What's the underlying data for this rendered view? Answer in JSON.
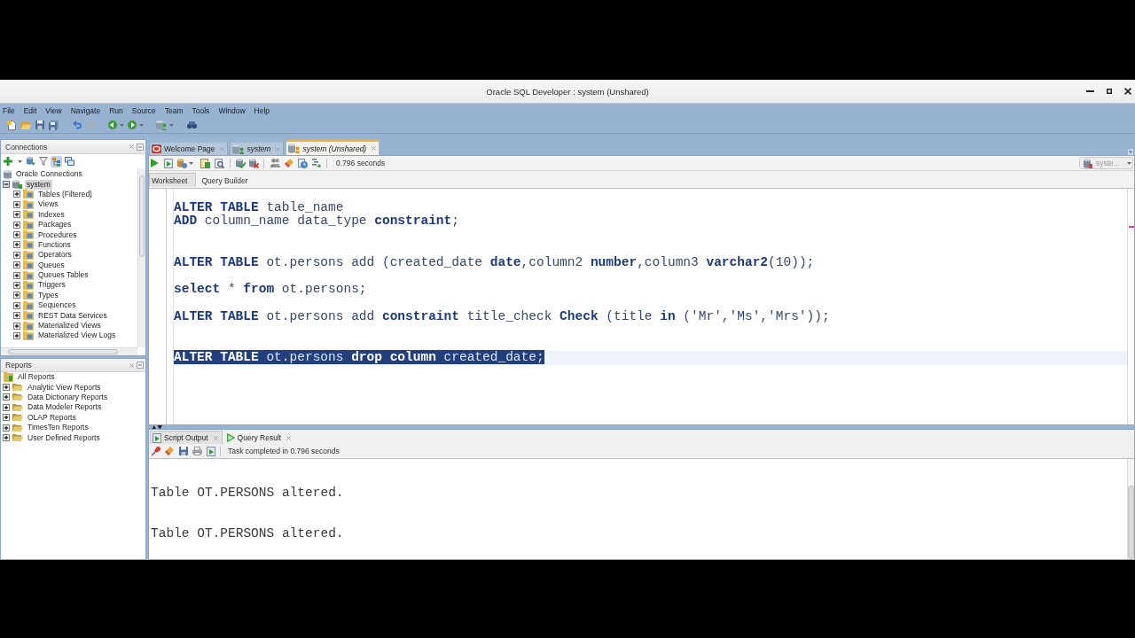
{
  "window": {
    "title": "Oracle SQL Developer : system (Unshared)"
  },
  "menu_bar": [
    "File",
    "Edit",
    "View",
    "Navigate",
    "Run",
    "Source",
    "Team",
    "Tools",
    "Window",
    "Help"
  ],
  "connections_panel": {
    "title": "Connections",
    "tree": [
      {
        "label": "Oracle Connections",
        "selected": false,
        "children": [
          {
            "label": "system",
            "expanded": true,
            "selected": true,
            "children": [
              {
                "label": "Tables (Filtered)",
                "expanded": false,
                "selected": false
              },
              {
                "label": "Views",
                "expanded": false,
                "selected": false
              },
              {
                "label": "Indexes",
                "expanded": false,
                "selected": false
              },
              {
                "label": "Packages",
                "expanded": false,
                "selected": false
              },
              {
                "label": "Procedures",
                "expanded": false,
                "selected": false
              },
              {
                "label": "Functions",
                "expanded": false,
                "selected": false
              },
              {
                "label": "Operators",
                "expanded": false,
                "selected": false
              },
              {
                "label": "Queues",
                "expanded": false,
                "selected": false
              },
              {
                "label": "Queues Tables",
                "expanded": false,
                "selected": false
              },
              {
                "label": "Triggers",
                "expanded": false,
                "selected": false
              },
              {
                "label": "Types",
                "expanded": false,
                "selected": false
              },
              {
                "label": "Sequences",
                "expanded": false,
                "selected": false
              },
              {
                "label": "REST Data Services",
                "expanded": false,
                "selected": false
              },
              {
                "label": "Materialized Views",
                "expanded": false,
                "selected": false
              },
              {
                "label": "Materialized View Logs",
                "expanded": false,
                "selected": false
              }
            ]
          }
        ]
      }
    ]
  },
  "reports_panel": {
    "title": "Reports",
    "tree": [
      {
        "label": "All Reports",
        "selected": false,
        "children": [
          {
            "label": "Analytic View Reports",
            "expanded": false,
            "selected": false
          },
          {
            "label": "Data Dictionary Reports",
            "expanded": false,
            "selected": false
          },
          {
            "label": "Data Modeler Reports",
            "expanded": false,
            "selected": false
          },
          {
            "label": "OLAP Reports",
            "expanded": false,
            "selected": false
          },
          {
            "label": "TimesTen Reports",
            "expanded": false,
            "selected": false
          },
          {
            "label": "User Defined Reports",
            "expanded": false,
            "selected": false
          }
        ]
      }
    ]
  },
  "editor": {
    "tabs": [
      {
        "label": "Welcome Page",
        "selected": false,
        "kind": "welcome"
      },
      {
        "label": "system",
        "selected": false,
        "kind": "worksheet"
      },
      {
        "label": "system (Unshared)",
        "selected": true,
        "kind": "unshared_worksheet"
      }
    ],
    "elapsed": "0.796 seconds",
    "connection_selector": {
      "value": "syste...",
      "disabled": true
    },
    "subtabs": [
      {
        "label": "Worksheet",
        "selected": true
      },
      {
        "label": "Query Builder",
        "selected": false
      }
    ],
    "lines": [
      {
        "kind": "code",
        "selected": false,
        "segments": [
          {
            "kind": "keyword",
            "text": "ALTER TABLE"
          },
          {
            "kind": "plain",
            "text": " table_name"
          }
        ]
      },
      {
        "kind": "code",
        "selected": false,
        "segments": [
          {
            "kind": "keyword",
            "text": "ADD"
          },
          {
            "kind": "plain",
            "text": " column_name data_type "
          },
          {
            "kind": "keyword",
            "text": "constraint"
          },
          {
            "kind": "plain",
            "text": ";"
          }
        ]
      },
      {
        "kind": "blank",
        "selected": false
      },
      {
        "kind": "blank",
        "selected": false
      },
      {
        "kind": "code",
        "selected": false,
        "segments": [
          {
            "kind": "keyword",
            "text": "ALTER TABLE"
          },
          {
            "kind": "plain",
            "text": " ot.persons add (created_date "
          },
          {
            "kind": "keyword",
            "text": "date"
          },
          {
            "kind": "plain",
            "text": ",column2 "
          },
          {
            "kind": "keyword",
            "text": "number"
          },
          {
            "kind": "plain",
            "text": ",column3 "
          },
          {
            "kind": "keyword",
            "text": "varchar2"
          },
          {
            "kind": "plain",
            "text": "(10));"
          }
        ]
      },
      {
        "kind": "blank",
        "selected": false
      },
      {
        "kind": "code",
        "selected": false,
        "segments": [
          {
            "kind": "keyword",
            "text": "select"
          },
          {
            "kind": "plain",
            "text": " * "
          },
          {
            "kind": "keyword",
            "text": "from"
          },
          {
            "kind": "plain",
            "text": " ot.persons;"
          }
        ]
      },
      {
        "kind": "blank",
        "selected": false
      },
      {
        "kind": "code",
        "selected": false,
        "segments": [
          {
            "kind": "keyword",
            "text": "ALTER TABLE"
          },
          {
            "kind": "plain",
            "text": " ot.persons add "
          },
          {
            "kind": "keyword",
            "text": "constraint"
          },
          {
            "kind": "plain",
            "text": " title_check "
          },
          {
            "kind": "keyword",
            "text": "Check"
          },
          {
            "kind": "plain",
            "text": " (title "
          },
          {
            "kind": "keyword",
            "text": "in"
          },
          {
            "kind": "plain",
            "text": " ('Mr','Ms','Mrs'));"
          }
        ]
      },
      {
        "kind": "blank",
        "selected": false
      },
      {
        "kind": "blank",
        "selected": false
      },
      {
        "kind": "code",
        "selected": true,
        "segments": [
          {
            "kind": "keyword",
            "text": "ALTER TABLE"
          },
          {
            "kind": "plain",
            "text": " ot.persons "
          },
          {
            "kind": "keyword",
            "text": "drop column"
          },
          {
            "kind": "plain",
            "text": " created_date;"
          }
        ]
      }
    ]
  },
  "output": {
    "tabs": [
      {
        "label": "Script Output",
        "selected": true,
        "kind": "script"
      },
      {
        "label": "Query Result",
        "selected": false,
        "kind": "query"
      }
    ],
    "status": "Task completed in 0.796 seconds",
    "lines": [
      {
        "kind": "blank"
      },
      {
        "kind": "blank"
      },
      {
        "kind": "text",
        "text": "Table OT.PERSONS altered."
      },
      {
        "kind": "blank"
      },
      {
        "kind": "blank"
      },
      {
        "kind": "text",
        "text": "Table OT.PERSONS altered."
      }
    ]
  }
}
